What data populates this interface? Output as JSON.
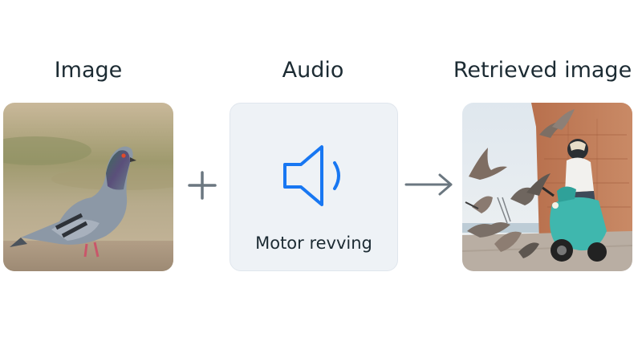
{
  "labels": {
    "image": "Image",
    "audio": "Audio",
    "retrieved": "Retrieved image"
  },
  "audio_card": {
    "caption": "Motor revving",
    "icon": "speaker-icon"
  },
  "operators": {
    "combine": "plus-icon",
    "result": "arrow-right-icon"
  },
  "colors": {
    "accent_blue": "#1877f2",
    "operator_gray": "#6b7780",
    "card_bg": "#eef2f6",
    "text": "#1c2b33"
  },
  "images": {
    "input": "pigeon-photo",
    "output": "scooter-rider-with-pigeons-photo"
  }
}
